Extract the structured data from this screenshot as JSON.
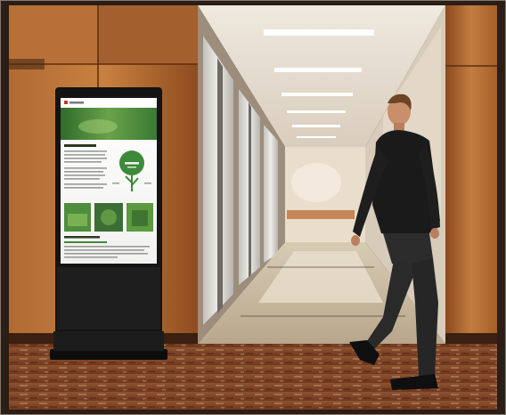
{
  "scene": {
    "description_tags": [
      "hallway",
      "digital-signage-kiosk",
      "man-walking",
      "elevator-lobby",
      "wood-panels",
      "carpet"
    ]
  },
  "kiosk_screen": {
    "brand": "",
    "title": "",
    "counter_value": "",
    "counter_caption": "",
    "section_title": ""
  },
  "colors": {
    "wood_light": "#c07a3f",
    "wood_dark": "#7a3f17",
    "ceiling": "#f3f0ea",
    "carpet_base": "#8a4a2a",
    "kiosk_body": "#161616",
    "screen_green": "#3f8a3a",
    "shirt": "#1a1a1a"
  }
}
